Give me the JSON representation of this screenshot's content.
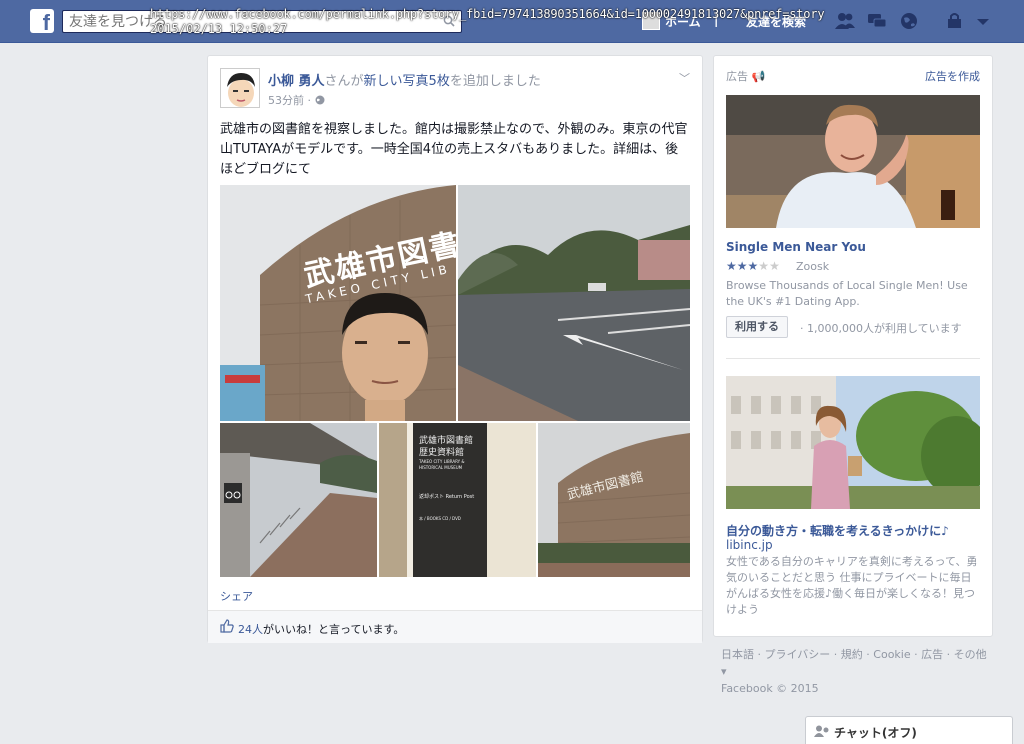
{
  "topbar": {
    "logo": "f",
    "search_placeholder": "友達を見つける",
    "overlay_url": "https://www.facebook.com/permalink.php?story_fbid=797413890351664&id=100002491813027&pnref=story",
    "overlay_time": "2015/02/13  12:50:27",
    "home_label": "ホーム",
    "find_friends_label": "友達を検索"
  },
  "post": {
    "author": "小柳 勇人",
    "action_pre": "さんが",
    "action_link": "新しい写真5枚",
    "action_post": "を追加しました",
    "time": "53分前",
    "text": "武雄市の図書館を視察しました。館内は撮影禁止なので、外観のみ。東京の代官山TUTAYAがモデルです。一時全国4位の売上スタバもありました。詳細は、後ほどブログにて",
    "share_label": "シェア",
    "likes_count": "24人",
    "likes_text": "がいいね！と言っています。",
    "photo_signs": {
      "library_sign": "武雄市図書",
      "library_sign_en": "TAKEO CITY LIB",
      "pillar_line1": "武雄市図書館",
      "pillar_line2": "歴史資料館",
      "pillar_en": "TAKEO CITY LIBRARY & HISTORICAL MUSEUM",
      "pillar_return": "返却ポスト  Return Post",
      "pillar_books": "本 / BOOKS      CD / DVD",
      "curved_sign": "武雄市図書館"
    }
  },
  "ads": {
    "title": "広告",
    "create_label": "広告を作成",
    "ad1": {
      "headline": "Single Men Near You",
      "brand": "Zoosk",
      "rating": 3,
      "max_rating": 5,
      "body": "Browse Thousands of Local Single Men! Use the UK's #1 Dating App.",
      "button": "利用する",
      "users": "· 1,000,000人が利用しています"
    },
    "ad2": {
      "headline": "自分の動き方・転職を考えるきっかけに♪",
      "domain": "libinc.jp",
      "body": "女性である自分のキャリアを真剣に考えるって、勇気のいることだと思う 仕事にプライベートに毎日がんばる女性を応援♪働く毎日が楽しくなる！見つけよう"
    }
  },
  "footer": {
    "links": [
      "日本語",
      "プライバシー",
      "規約",
      "Cookie",
      "広告",
      "その他"
    ],
    "copyright": "Facebook © 2015"
  },
  "chat": {
    "label": "チャット(オフ)"
  },
  "colors": {
    "topbar": "#4e69a2",
    "link": "#3b5998",
    "muted": "#9197a3",
    "background": "#e9ebee"
  }
}
